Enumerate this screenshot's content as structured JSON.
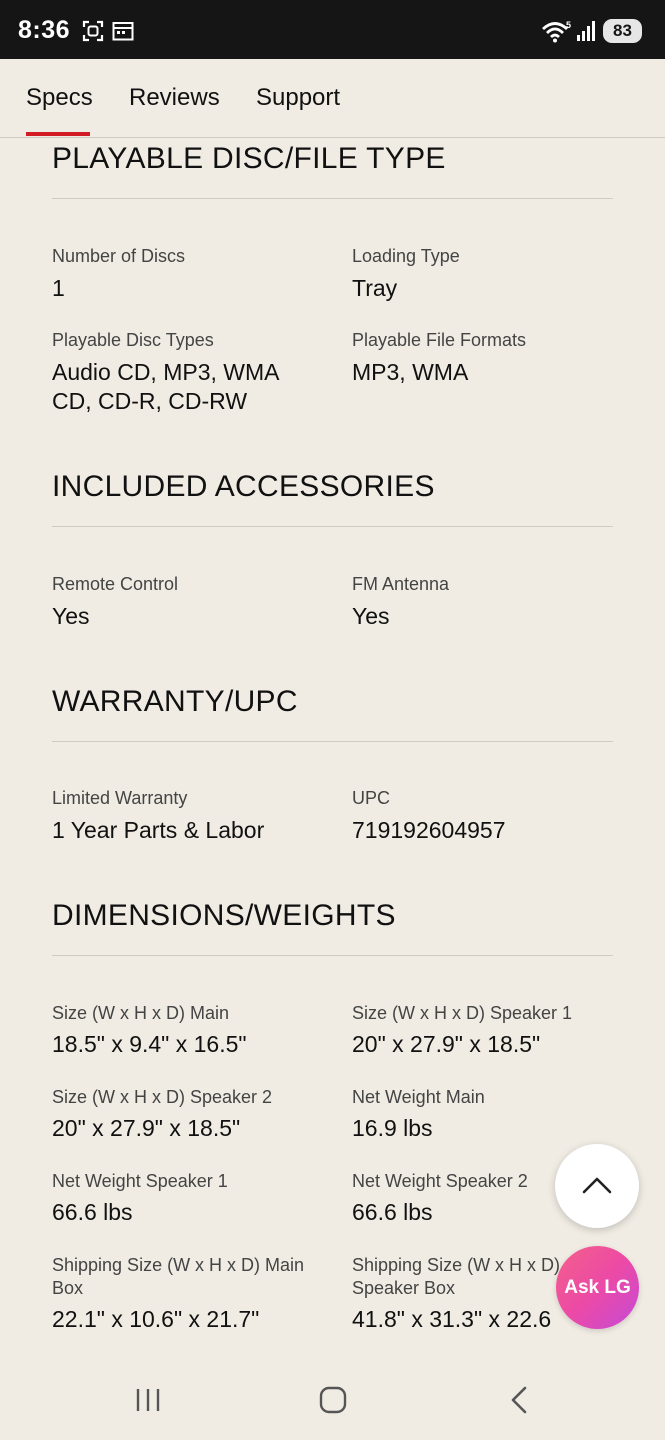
{
  "status_bar": {
    "time": "8:36",
    "battery": "83"
  },
  "tabs": [
    {
      "label": "Specs",
      "active": true
    },
    {
      "label": "Reviews",
      "active": false
    },
    {
      "label": "Support",
      "active": false
    }
  ],
  "sections": {
    "playable": {
      "title": "PLAYABLE DISC/FILE TYPE",
      "specs": [
        {
          "label": "Number of Discs",
          "value": "1"
        },
        {
          "label": "Loading Type",
          "value": "Tray"
        },
        {
          "label": "Playable Disc Types",
          "value": "Audio CD, MP3, WMA CD, CD-R, CD-RW"
        },
        {
          "label": "Playable File Formats",
          "value": "MP3, WMA"
        }
      ]
    },
    "accessories": {
      "title": "INCLUDED ACCESSORIES",
      "specs": [
        {
          "label": "Remote Control",
          "value": "Yes"
        },
        {
          "label": "FM Antenna",
          "value": "Yes"
        }
      ]
    },
    "warranty": {
      "title": "WARRANTY/UPC",
      "specs": [
        {
          "label": "Limited Warranty",
          "value": "1 Year Parts & Labor"
        },
        {
          "label": "UPC",
          "value": "719192604957"
        }
      ]
    },
    "dimensions": {
      "title": "DIMENSIONS/WEIGHTS",
      "specs": [
        {
          "label": "Size (W x H x D) Main",
          "value": "18.5\" x 9.4\" x 16.5\""
        },
        {
          "label": "Size (W x H x D) Speaker 1",
          "value": "20\" x 27.9\" x 18.5\""
        },
        {
          "label": "Size (W x H x D) Speaker 2",
          "value": "20\" x 27.9\" x 18.5\""
        },
        {
          "label": "Net Weight Main",
          "value": "16.9 lbs"
        },
        {
          "label": "Net Weight Speaker 1",
          "value": "66.6 lbs"
        },
        {
          "label": "Net Weight Speaker 2",
          "value": "66.6 lbs"
        },
        {
          "label": "Shipping Size (W x H x D) Main Box",
          "value": "22.1\" x 10.6\" x 21.7\""
        },
        {
          "label": "Shipping Size (W x H x D) Speaker Box",
          "value": "41.8\" x 31.3\" x 22.6"
        }
      ]
    }
  },
  "floating": {
    "ask_label": "Ask LG"
  },
  "colors": {
    "accent": "#d11c26",
    "background": "#f0ece4",
    "ask_gradient_start": "#f4608a",
    "ask_gradient_end": "#c54ad8"
  }
}
